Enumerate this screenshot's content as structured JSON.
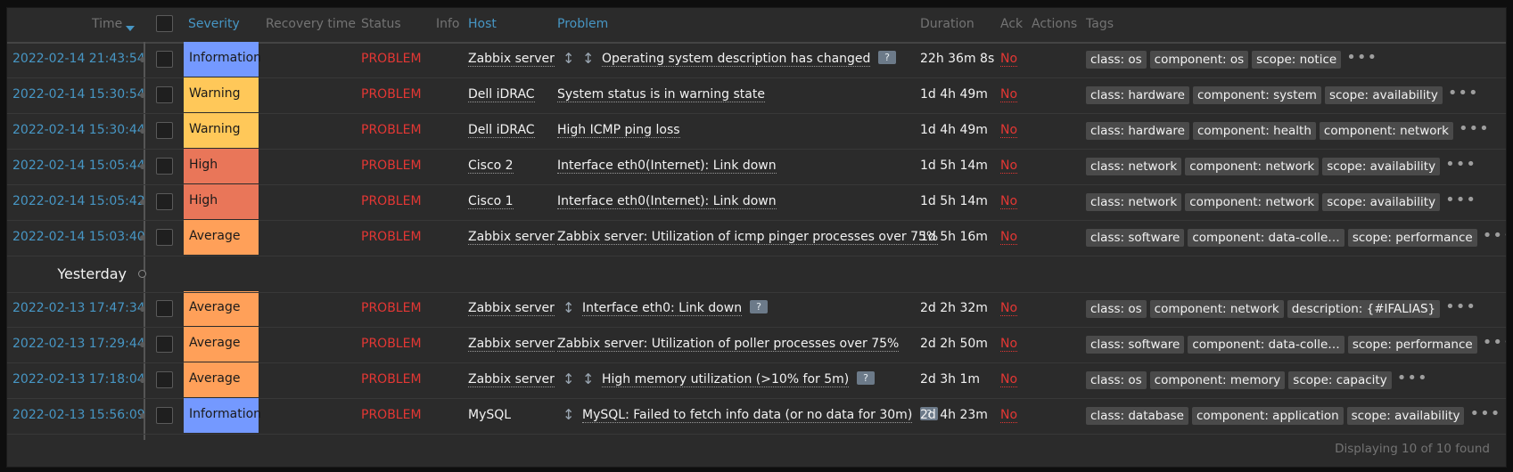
{
  "header": {
    "time": "Time",
    "severity": "Severity",
    "recovery_time": "Recovery time",
    "status": "Status",
    "info": "Info",
    "host": "Host",
    "problem": "Problem",
    "duration": "Duration",
    "ack": "Ack",
    "actions": "Actions",
    "tags": "Tags"
  },
  "colors": {
    "information": "#7499ff",
    "warning": "#ffc859",
    "average": "#ffa059",
    "high": "#e97659",
    "problem": "#e33734",
    "link": "#4796c4"
  },
  "separator": "Yesterday",
  "rows": [
    {
      "time": "2022-02-14 21:43:54",
      "severity": "Information",
      "status": "PROBLEM",
      "host": "Zabbix server",
      "icons": [
        "updown-icon",
        "updown-icon"
      ],
      "problem": "Operating system description has changed",
      "question": true,
      "duration": "22h 36m 8s",
      "ack": "No",
      "tags": [
        "class: os",
        "component: os",
        "scope: notice"
      ]
    },
    {
      "time": "2022-02-14 15:30:54",
      "severity": "Warning",
      "status": "PROBLEM",
      "host": "Dell iDRAC",
      "icons": [],
      "problem": "System status is in warning state",
      "question": false,
      "duration": "1d 4h 49m",
      "ack": "No",
      "tags": [
        "class: hardware",
        "component: system",
        "scope: availability"
      ]
    },
    {
      "time": "2022-02-14 15:30:44",
      "severity": "Warning",
      "status": "PROBLEM",
      "host": "Dell iDRAC",
      "icons": [],
      "problem": "High ICMP ping loss",
      "question": false,
      "duration": "1d 4h 49m",
      "ack": "No",
      "tags": [
        "class: hardware",
        "component: health",
        "component: network"
      ]
    },
    {
      "time": "2022-02-14 15:05:44",
      "severity": "High",
      "status": "PROBLEM",
      "host": "Cisco 2",
      "icons": [],
      "problem": "Interface eth0(Internet): Link down",
      "question": false,
      "duration": "1d 5h 14m",
      "ack": "No",
      "tags": [
        "class: network",
        "component: network",
        "scope: availability"
      ]
    },
    {
      "time": "2022-02-14 15:05:42",
      "severity": "High",
      "status": "PROBLEM",
      "host": "Cisco 1",
      "icons": [],
      "problem": "Interface eth0(Internet): Link down",
      "question": false,
      "duration": "1d 5h 14m",
      "ack": "No",
      "tags": [
        "class: network",
        "component: network",
        "scope: availability"
      ]
    },
    {
      "time": "2022-02-14 15:03:40",
      "severity": "Average",
      "status": "PROBLEM",
      "host": "Zabbix server",
      "icons": [],
      "problem": "Zabbix server: Utilization of icmp pinger processes over 75%",
      "question": false,
      "duration": "1d 5h 16m",
      "ack": "No",
      "tags": [
        "class: software",
        "component: data-colle…",
        "scope: performance"
      ]
    },
    {
      "time": "2022-02-13 17:47:34",
      "severity": "Average",
      "status": "PROBLEM",
      "host": "Zabbix server",
      "icons": [
        "updown-icon"
      ],
      "problem": "Interface eth0: Link down",
      "question": true,
      "duration": "2d 2h 32m",
      "ack": "No",
      "tags": [
        "class: os",
        "component: network",
        "description: {#IFALIAS}"
      ]
    },
    {
      "time": "2022-02-13 17:29:44",
      "severity": "Average",
      "status": "PROBLEM",
      "host": "Zabbix server",
      "icons": [],
      "problem": "Zabbix server: Utilization of poller processes over 75%",
      "question": false,
      "duration": "2d 2h 50m",
      "ack": "No",
      "tags": [
        "class: software",
        "component: data-colle…",
        "scope: performance"
      ]
    },
    {
      "time": "2022-02-13 17:18:04",
      "severity": "Average",
      "status": "PROBLEM",
      "host": "Zabbix server",
      "icons": [
        "updown-icon",
        "updown-icon"
      ],
      "problem": "High memory utilization (>10% for 5m)",
      "question": true,
      "duration": "2d 3h 1m",
      "ack": "No",
      "tags": [
        "class: os",
        "component: memory",
        "scope: capacity"
      ]
    },
    {
      "time": "2022-02-13 15:56:09",
      "severity": "Information",
      "status": "PROBLEM",
      "host": "MySQL",
      "icons": [
        "updown-icon"
      ],
      "problem": "MySQL: Failed to fetch info data (or no data for 30m)",
      "question": true,
      "duration": "2d 4h 23m",
      "ack": "No",
      "tags": [
        "class: database",
        "component: application",
        "scope: availability"
      ]
    }
  ],
  "footer": "Displaying 10 of 10 found"
}
